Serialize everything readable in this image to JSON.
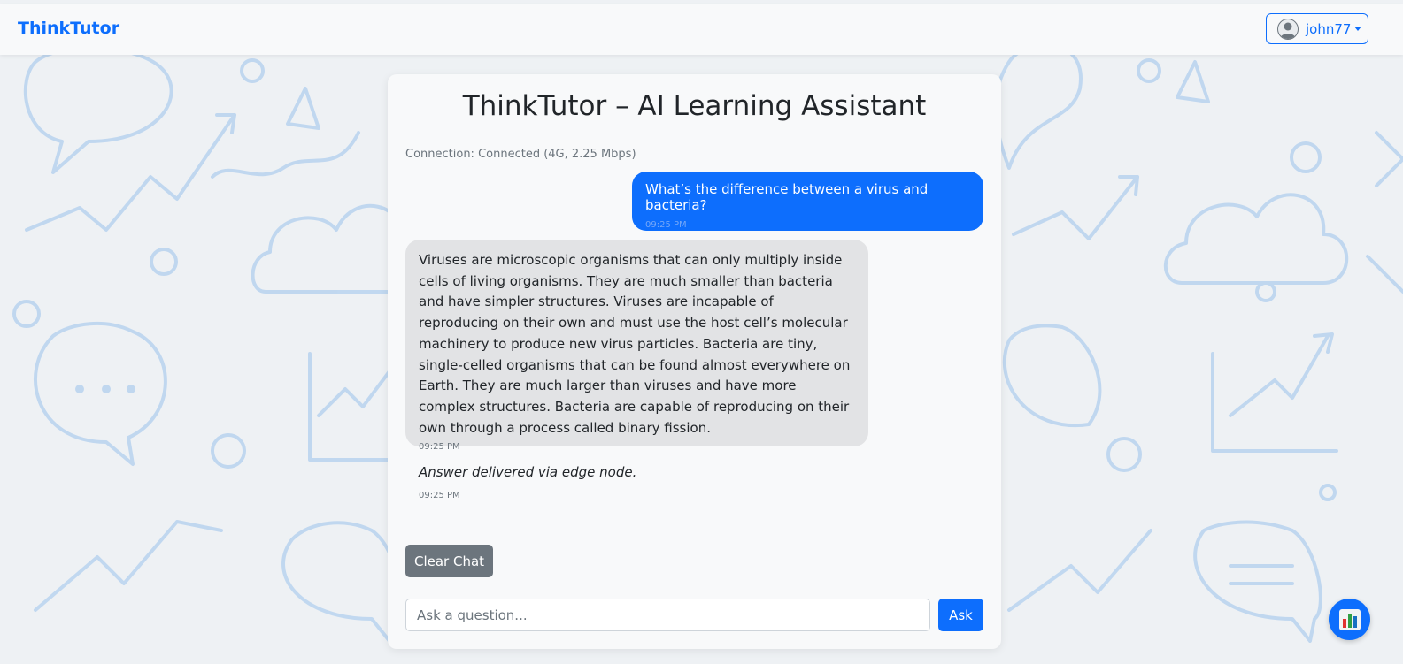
{
  "navbar": {
    "brand": "ThinkTutor",
    "user": {
      "name": "john77",
      "avatar_icon": "user-avatar-icon"
    }
  },
  "chat": {
    "title": "ThinkTutor – AI Learning Assistant",
    "connection_status": "Connection: Connected (4G, 2.25 Mbps)",
    "messages": [
      {
        "role": "user",
        "text": "What’s the difference between a virus and bacteria?",
        "time": "09:25 PM"
      },
      {
        "role": "assistant",
        "text": "Viruses are microscopic organisms that can only multiply inside cells of living organisms. They are much smaller than bacteria and have simpler structures. Viruses are incapable of reproducing on their own and must use the host cell’s molecular machinery to produce new virus particles. Bacteria are tiny, single-celled organisms that can be found almost everywhere on Earth. They are much larger than viruses and have more complex structures. Bacteria are capable of reproducing on their own through a process called binary fission.",
        "time": "09:25 PM"
      },
      {
        "role": "system",
        "text": "Answer delivered via edge node.",
        "time": "09:25 PM"
      }
    ],
    "clear_label": "Clear Chat",
    "input": {
      "placeholder": "Ask a question...",
      "value": ""
    },
    "ask_label": "Ask"
  },
  "fab": {
    "icon": "bar-chart-icon"
  },
  "colors": {
    "primary": "#0d6efd",
    "secondary": "#6c757d",
    "bubble_assistant": "#e2e3e5",
    "card_bg": "#f8f9fa"
  }
}
